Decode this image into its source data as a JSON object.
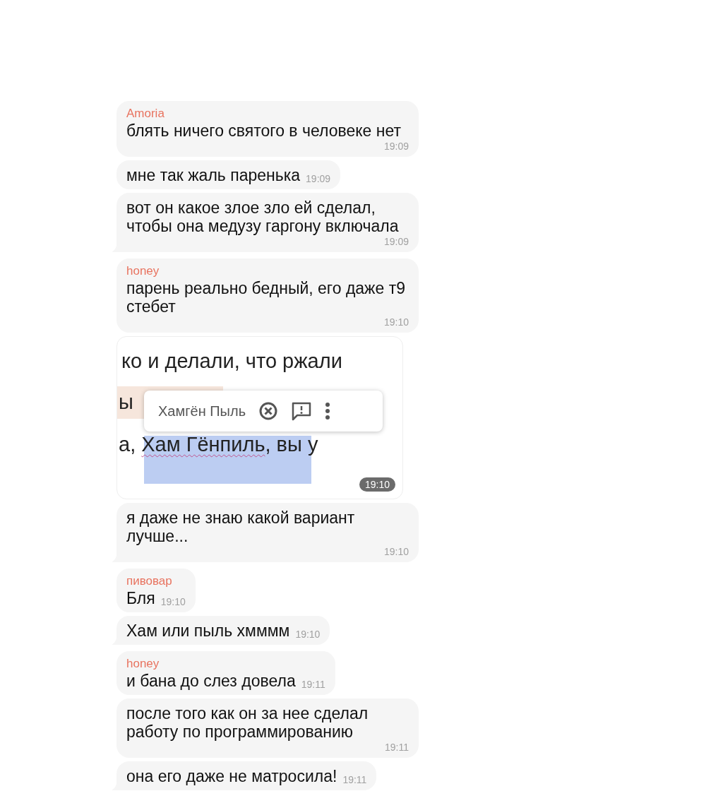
{
  "messages": [
    {
      "kind": "text",
      "sender": "Amoria",
      "text": "блять ничего святого в человеке нет",
      "time": "19:09",
      "tail": false
    },
    {
      "kind": "text",
      "text": "мне так жаль паренька",
      "time": "19:09",
      "tail": false
    },
    {
      "kind": "text",
      "text": "вот он какое злое зло ей сделал, чтобы она медузу гаргону включала",
      "time": "19:09",
      "tail": true
    },
    {
      "kind": "text",
      "sender": "honey",
      "text": "парень реально бедный, его даже т9 стебет",
      "time": "19:10",
      "tail": false
    },
    {
      "kind": "image",
      "lines": [
        "ко и делали, что ржали",
        "ы"
      ],
      "last_line": {
        "before": "а, ",
        "selected": "Хам Гёнпиль",
        "after": ", вы у"
      },
      "suggestion": "Хамгён Пыль",
      "time": "19:10"
    },
    {
      "kind": "text",
      "text": "я даже не знаю какой вариант лучше...",
      "time": "19:10",
      "tail": true
    },
    {
      "kind": "text",
      "sender": "пивовар",
      "text": "Бля",
      "time": "19:10",
      "tail": false
    },
    {
      "kind": "text",
      "text": "Хам или пыль хмммм",
      "time": "19:10",
      "tail": true
    },
    {
      "kind": "text",
      "sender": "honey",
      "text": "и бана до слез довела",
      "time": "19:11",
      "tail": false
    },
    {
      "kind": "text",
      "text": "после того как он за нее сделал работу по программированию",
      "time": "19:11",
      "tail": false
    },
    {
      "kind": "text",
      "text": "она его даже не матросила!",
      "time": "19:11",
      "tail": true
    }
  ]
}
